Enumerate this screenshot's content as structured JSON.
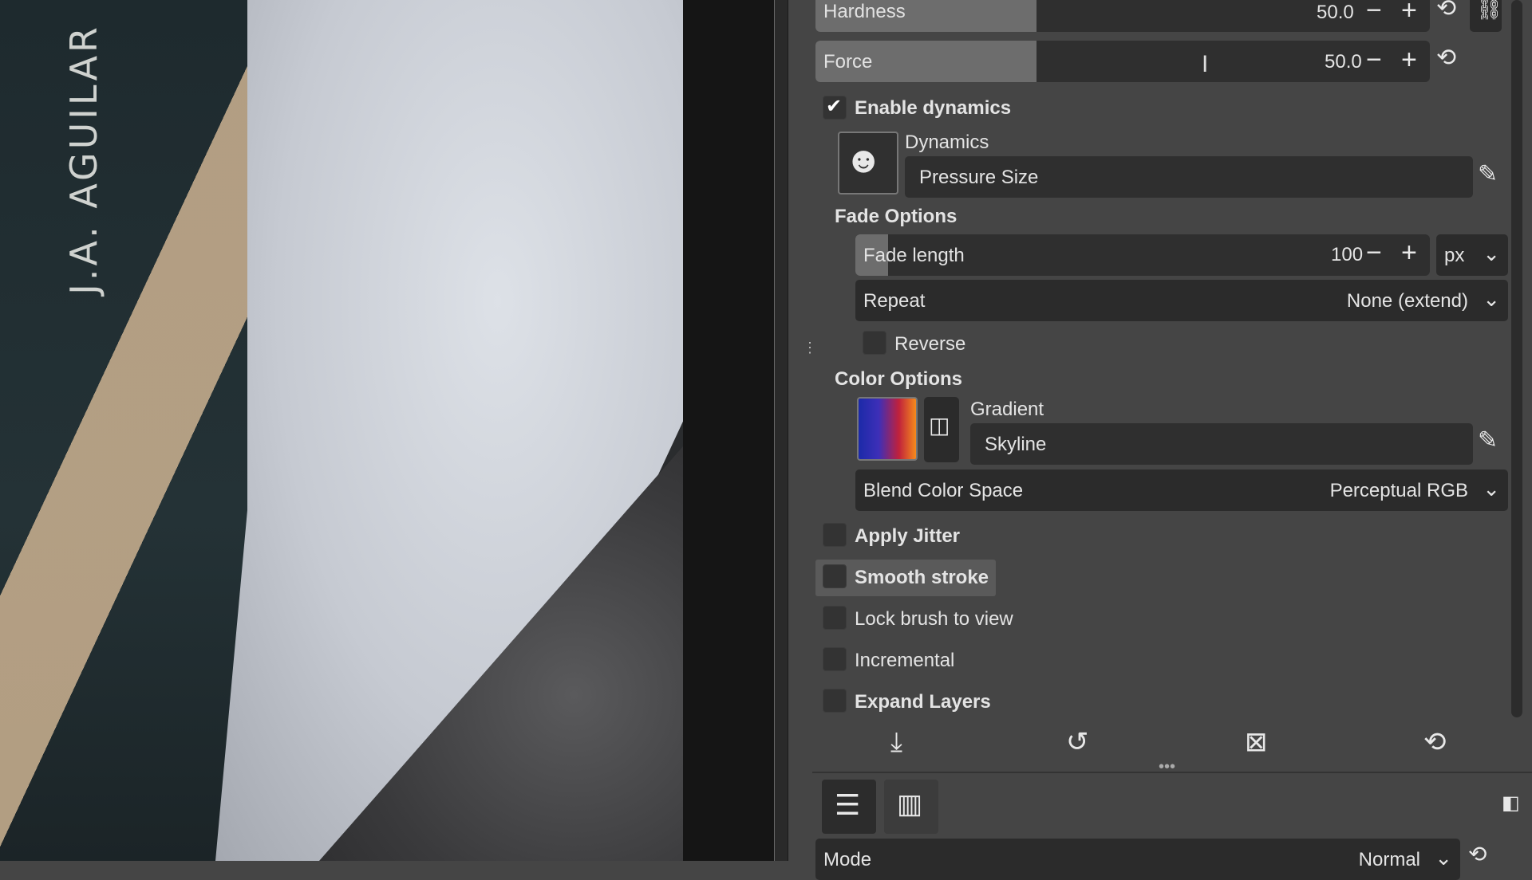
{
  "canvas": {
    "author_text": "J.A. AGUILAR"
  },
  "sliders": {
    "hardness": {
      "label": "Hardness",
      "value": "50.0",
      "fraction": 0.5
    },
    "force": {
      "label": "Force",
      "value": "50.0",
      "fraction": 0.5
    },
    "fade_length": {
      "label": "Fade length",
      "value": "100",
      "unit": "px",
      "fraction": 0.08
    }
  },
  "dynamics": {
    "enable_label": "Enable dynamics",
    "enabled": true,
    "heading": "Dynamics",
    "value": "Pressure Size"
  },
  "fade": {
    "heading": "Fade Options",
    "repeat_label": "Repeat",
    "repeat_value": "None (extend)",
    "reverse_label": "Reverse"
  },
  "color": {
    "heading": "Color Options",
    "gradient_heading": "Gradient",
    "gradient_value": "Skyline",
    "blend_label": "Blend Color Space",
    "blend_value": "Perceptual RGB"
  },
  "options": {
    "apply_jitter": "Apply Jitter",
    "smooth_stroke": "Smooth stroke",
    "lock_brush": "Lock brush to view",
    "incremental": "Incremental",
    "expand_layers": "Expand Layers"
  },
  "mode": {
    "label": "Mode",
    "value": "Normal"
  },
  "colors": {
    "panel": "#454545",
    "slider_fill": "#6d6d6d",
    "field": "#2f2f2f"
  }
}
